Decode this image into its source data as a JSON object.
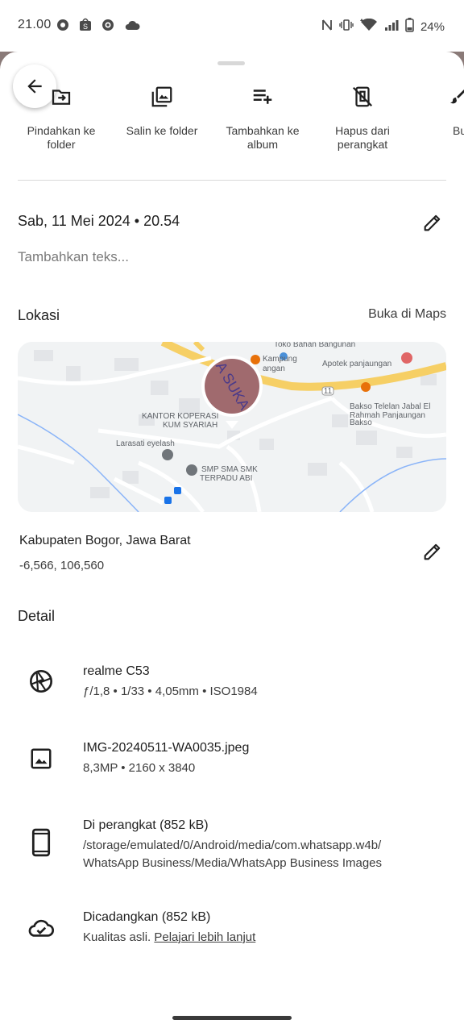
{
  "status_bar": {
    "time": "21.00",
    "battery": "24%"
  },
  "actions": [
    {
      "label": "Pindahkan ke folder",
      "icon": "move-to-folder-icon"
    },
    {
      "label": "Salin ke folder",
      "icon": "copy-to-folder-icon"
    },
    {
      "label": "Tambahkan ke album",
      "icon": "add-to-album-icon"
    },
    {
      "label": "Hapus dari perangkat",
      "icon": "delete-from-device-icon"
    },
    {
      "label": "Bu",
      "icon": "edit-brush-icon"
    }
  ],
  "photo": {
    "datetime": "Sab, 11 Mei 2024  •  20.54",
    "add_text_placeholder": "Tambahkan teks..."
  },
  "location": {
    "heading": "Lokasi",
    "open_maps": "Buka di Maps",
    "place": "Kabupaten Bogor, Jawa Barat",
    "coords": "-6,566, 106,560",
    "map_labels": {
      "toko": "Toko Bahan Bangunan",
      "apotek": "Apotek panjaungan",
      "kampung1": "Kampung",
      "kampung2": "angan",
      "road": "11",
      "bakso1": "Bakso Telelan Jabal El",
      "bakso2": "Rahmah Panjaungan",
      "bakso3": "Bakso",
      "kantor1": "KANTOR KOPERASI",
      "kantor2": "KUM SYARIAH",
      "larasati": "Larasati eyelash",
      "smp1": "SMP SMA SMK",
      "smp2": "TERPADU ABI",
      "photo_text": "A SUKA"
    }
  },
  "detail": {
    "heading": "Detail",
    "camera": {
      "title": "realme C53",
      "sub": "ƒ/1,8  •  1/33  •  4,05mm  •  ISO1984"
    },
    "file": {
      "title": "IMG-20240511-WA0035.jpeg",
      "sub": "8,3MP  •  2160 x 3840"
    },
    "device": {
      "title": "Di perangkat (852 kB)",
      "path1": "/storage/emulated/0/Android/media/com.whatsapp.w4b/",
      "path2": "WhatsApp Business/Media/WhatsApp Business Images"
    },
    "backup": {
      "title": "Dicadangkan (852 kB)",
      "sub_prefix": "Kualitas asli. ",
      "learn_more": "Pelajari lebih lanjut"
    }
  },
  "colors": {
    "map_road_major": "#f6cf65",
    "map_water": "#8ab4f8",
    "map_red_poi": "#e06666",
    "map_orange_poi": "#e8710a"
  }
}
